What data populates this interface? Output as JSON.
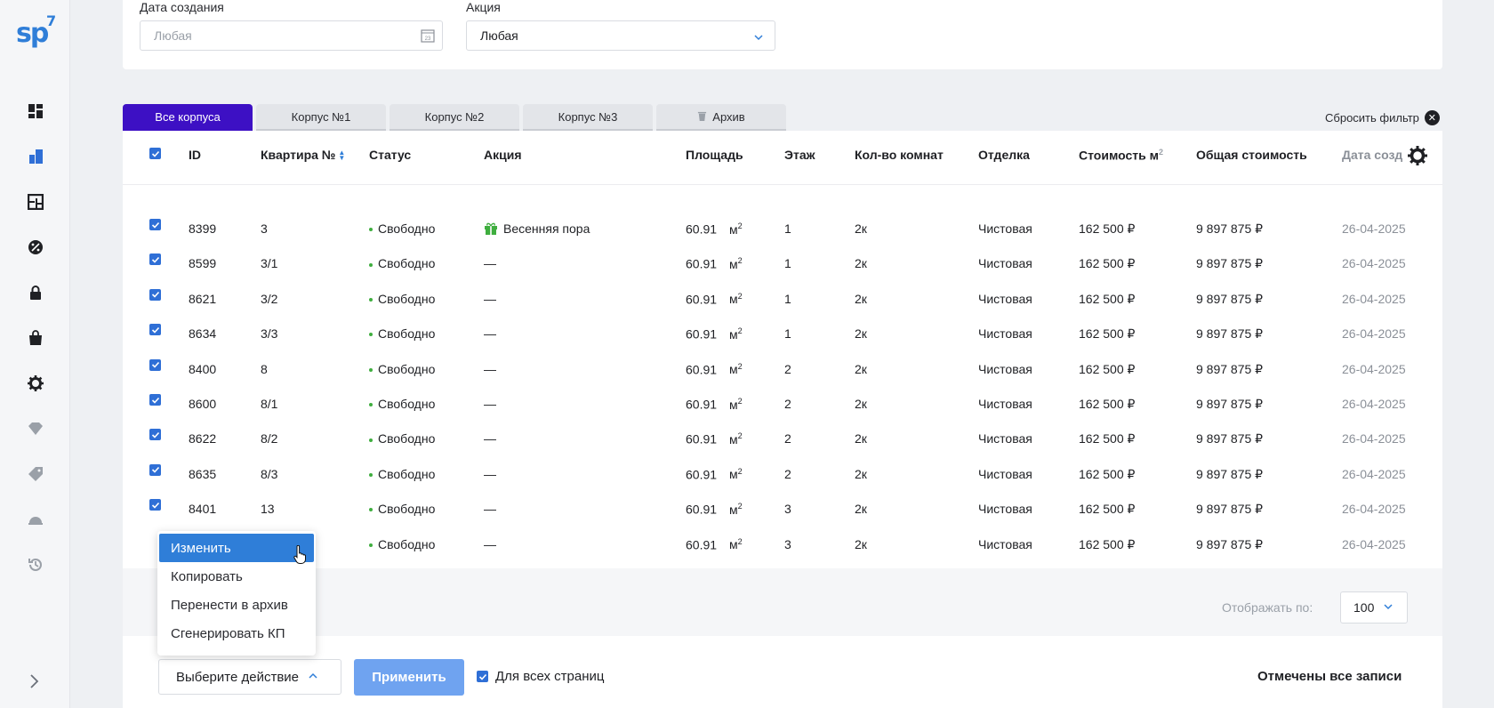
{
  "app": {
    "logo": "sp",
    "logo_mark": "7"
  },
  "sidebar": {
    "icons": [
      "dashboard-icon",
      "buildings-icon",
      "floorplan-icon",
      "discount-icon",
      "lock-icon",
      "bag-icon",
      "settings-gear-icon",
      "diamond-icon",
      "tag-icon",
      "helmet-icon",
      "history-icon"
    ],
    "expand_icon": "chevron-right-icon"
  },
  "filters": {
    "date_label": "Дата создания",
    "date_placeholder": "Любая",
    "promo_label": "Акция",
    "promo_value": "Любая"
  },
  "tabs": [
    {
      "label": "Все корпуса",
      "active": true
    },
    {
      "label": "Корпус №1",
      "active": false
    },
    {
      "label": "Корпус №2",
      "active": false
    },
    {
      "label": "Корпус №3",
      "active": false
    },
    {
      "label": "Архив",
      "active": false,
      "icon": "trash-icon"
    }
  ],
  "reset_filter": "Сбросить фильтр",
  "table": {
    "headers": {
      "id": "ID",
      "apt": "Квартира №",
      "status": "Статус",
      "promo": "Акция",
      "area": "Площадь",
      "floor": "Этаж",
      "rooms": "Кол-во комнат",
      "finish": "Отделка",
      "price_m2": "Стоимость м",
      "total": "Общая стоимость",
      "date": "Дата созд"
    },
    "rows": [
      {
        "id": "8399",
        "apt": "3",
        "status": "Свободно",
        "promo": "Весенняя пора",
        "area": "60.91",
        "unit": "м",
        "floor": "1",
        "rooms": "2к",
        "finish": "Чистовая",
        "price": "162 500 ₽",
        "total": "9 897 875 ₽",
        "date": "26-04-2025"
      },
      {
        "id": "8599",
        "apt": "3/1",
        "status": "Свободно",
        "promo": "—",
        "area": "60.91",
        "unit": "м",
        "floor": "1",
        "rooms": "2к",
        "finish": "Чистовая",
        "price": "162 500 ₽",
        "total": "9 897 875 ₽",
        "date": "26-04-2025"
      },
      {
        "id": "8621",
        "apt": "3/2",
        "status": "Свободно",
        "promo": "—",
        "area": "60.91",
        "unit": "м",
        "floor": "1",
        "rooms": "2к",
        "finish": "Чистовая",
        "price": "162 500 ₽",
        "total": "9 897 875 ₽",
        "date": "26-04-2025"
      },
      {
        "id": "8634",
        "apt": "3/3",
        "status": "Свободно",
        "promo": "—",
        "area": "60.91",
        "unit": "м",
        "floor": "1",
        "rooms": "2к",
        "finish": "Чистовая",
        "price": "162 500 ₽",
        "total": "9 897 875 ₽",
        "date": "26-04-2025"
      },
      {
        "id": "8400",
        "apt": "8",
        "status": "Свободно",
        "promo": "—",
        "area": "60.91",
        "unit": "м",
        "floor": "2",
        "rooms": "2к",
        "finish": "Чистовая",
        "price": "162 500 ₽",
        "total": "9 897 875 ₽",
        "date": "26-04-2025"
      },
      {
        "id": "8600",
        "apt": "8/1",
        "status": "Свободно",
        "promo": "—",
        "area": "60.91",
        "unit": "м",
        "floor": "2",
        "rooms": "2к",
        "finish": "Чистовая",
        "price": "162 500 ₽",
        "total": "9 897 875 ₽",
        "date": "26-04-2025"
      },
      {
        "id": "8622",
        "apt": "8/2",
        "status": "Свободно",
        "promo": "—",
        "area": "60.91",
        "unit": "м",
        "floor": "2",
        "rooms": "2к",
        "finish": "Чистовая",
        "price": "162 500 ₽",
        "total": "9 897 875 ₽",
        "date": "26-04-2025"
      },
      {
        "id": "8635",
        "apt": "8/3",
        "status": "Свободно",
        "promo": "—",
        "area": "60.91",
        "unit": "м",
        "floor": "2",
        "rooms": "2к",
        "finish": "Чистовая",
        "price": "162 500 ₽",
        "total": "9 897 875 ₽",
        "date": "26-04-2025"
      },
      {
        "id": "8401",
        "apt": "13",
        "status": "Свободно",
        "promo": "—",
        "area": "60.91",
        "unit": "м",
        "floor": "3",
        "rooms": "2к",
        "finish": "Чистовая",
        "price": "162 500 ₽",
        "total": "9 897 875 ₽",
        "date": "26-04-2025"
      },
      {
        "id": "",
        "apt": "",
        "status": "Свободно",
        "promo": "—",
        "area": "60.91",
        "unit": "м",
        "floor": "3",
        "rooms": "2к",
        "finish": "Чистовая",
        "price": "162 500 ₽",
        "total": "9 897 875 ₽",
        "date": "26-04-2025"
      }
    ]
  },
  "pagination": {
    "label": "Отображать по:",
    "value": "100"
  },
  "bulk": {
    "select_placeholder": "Выберите действие",
    "apply": "Применить",
    "all_pages": "Для всех страниц",
    "marked": "Отмечены все записи",
    "menu": [
      "Изменить",
      "Копировать",
      "Перенести в архив",
      "Сгенерировать КП"
    ]
  },
  "colors": {
    "accent": "#2f7ed8",
    "tab_active": "#3d10c4",
    "status_free": "#3fae3f",
    "promo_gift": "#3fae3f",
    "apply_btn": "#6fa3f0"
  }
}
